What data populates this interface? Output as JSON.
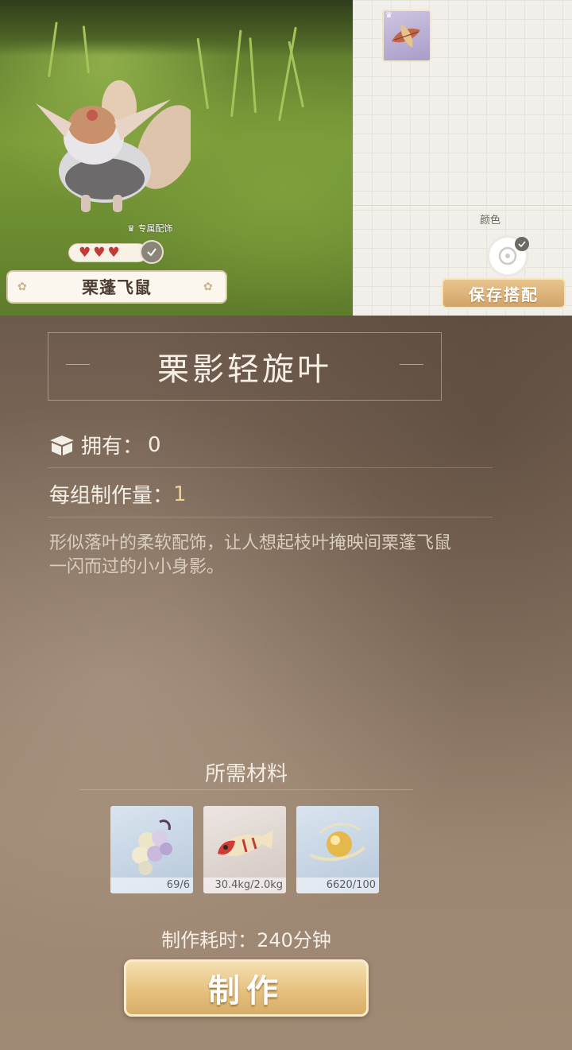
{
  "pet": {
    "name": "栗蓬飞鼠",
    "exclusive_tag": "专属配饰",
    "hearts": [
      "♥",
      "♥",
      "♥"
    ]
  },
  "side_panel": {
    "color_label": "颜色",
    "save_button": "保存搭配"
  },
  "item": {
    "title": "栗影轻旋叶",
    "owned_label": "拥有：",
    "owned_value": "0",
    "batch_label": "每组制作量：",
    "batch_value": "1",
    "description": "形似落叶的柔软配饰，让人想起枝叶掩映间栗蓬飞鼠一闪而过的小小身影。"
  },
  "materials": {
    "title": "所需材料",
    "items": [
      {
        "icon": "purple-berries-icon",
        "count": "69/6"
      },
      {
        "icon": "red-fish-icon",
        "count": "30.4kg/2.0kg"
      },
      {
        "icon": "golden-orb-icon",
        "count": "6620/100"
      }
    ]
  },
  "craft": {
    "time_text": "制作耗时：240分钟",
    "button_label": "制作"
  },
  "colors": {
    "accent_gold": "#e6c17f",
    "heart_red": "#c23a33",
    "batch_value_yellow": "#ecd18d"
  }
}
